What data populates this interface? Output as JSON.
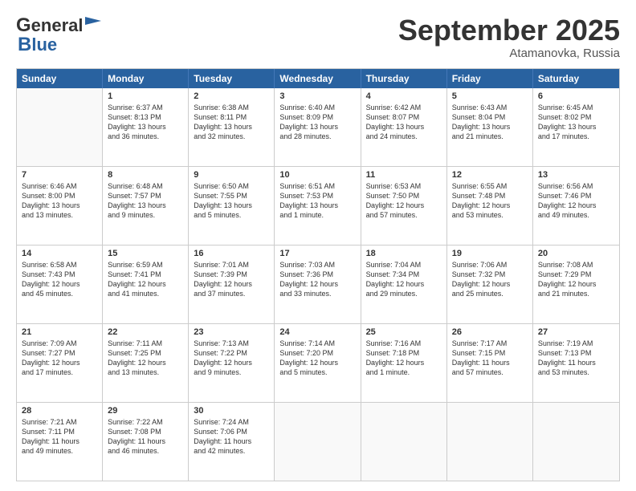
{
  "header": {
    "logo_general": "General",
    "logo_blue": "Blue",
    "month_title": "September 2025",
    "subtitle": "Atamanovka, Russia"
  },
  "days_of_week": [
    "Sunday",
    "Monday",
    "Tuesday",
    "Wednesday",
    "Thursday",
    "Friday",
    "Saturday"
  ],
  "weeks": [
    [
      {
        "day": "",
        "empty": true,
        "lines": []
      },
      {
        "day": "1",
        "empty": false,
        "lines": [
          "Sunrise: 6:37 AM",
          "Sunset: 8:13 PM",
          "Daylight: 13 hours",
          "and 36 minutes."
        ]
      },
      {
        "day": "2",
        "empty": false,
        "lines": [
          "Sunrise: 6:38 AM",
          "Sunset: 8:11 PM",
          "Daylight: 13 hours",
          "and 32 minutes."
        ]
      },
      {
        "day": "3",
        "empty": false,
        "lines": [
          "Sunrise: 6:40 AM",
          "Sunset: 8:09 PM",
          "Daylight: 13 hours",
          "and 28 minutes."
        ]
      },
      {
        "day": "4",
        "empty": false,
        "lines": [
          "Sunrise: 6:42 AM",
          "Sunset: 8:07 PM",
          "Daylight: 13 hours",
          "and 24 minutes."
        ]
      },
      {
        "day": "5",
        "empty": false,
        "lines": [
          "Sunrise: 6:43 AM",
          "Sunset: 8:04 PM",
          "Daylight: 13 hours",
          "and 21 minutes."
        ]
      },
      {
        "day": "6",
        "empty": false,
        "lines": [
          "Sunrise: 6:45 AM",
          "Sunset: 8:02 PM",
          "Daylight: 13 hours",
          "and 17 minutes."
        ]
      }
    ],
    [
      {
        "day": "7",
        "empty": false,
        "lines": [
          "Sunrise: 6:46 AM",
          "Sunset: 8:00 PM",
          "Daylight: 13 hours",
          "and 13 minutes."
        ]
      },
      {
        "day": "8",
        "empty": false,
        "lines": [
          "Sunrise: 6:48 AM",
          "Sunset: 7:57 PM",
          "Daylight: 13 hours",
          "and 9 minutes."
        ]
      },
      {
        "day": "9",
        "empty": false,
        "lines": [
          "Sunrise: 6:50 AM",
          "Sunset: 7:55 PM",
          "Daylight: 13 hours",
          "and 5 minutes."
        ]
      },
      {
        "day": "10",
        "empty": false,
        "lines": [
          "Sunrise: 6:51 AM",
          "Sunset: 7:53 PM",
          "Daylight: 13 hours",
          "and 1 minute."
        ]
      },
      {
        "day": "11",
        "empty": false,
        "lines": [
          "Sunrise: 6:53 AM",
          "Sunset: 7:50 PM",
          "Daylight: 12 hours",
          "and 57 minutes."
        ]
      },
      {
        "day": "12",
        "empty": false,
        "lines": [
          "Sunrise: 6:55 AM",
          "Sunset: 7:48 PM",
          "Daylight: 12 hours",
          "and 53 minutes."
        ]
      },
      {
        "day": "13",
        "empty": false,
        "lines": [
          "Sunrise: 6:56 AM",
          "Sunset: 7:46 PM",
          "Daylight: 12 hours",
          "and 49 minutes."
        ]
      }
    ],
    [
      {
        "day": "14",
        "empty": false,
        "lines": [
          "Sunrise: 6:58 AM",
          "Sunset: 7:43 PM",
          "Daylight: 12 hours",
          "and 45 minutes."
        ]
      },
      {
        "day": "15",
        "empty": false,
        "lines": [
          "Sunrise: 6:59 AM",
          "Sunset: 7:41 PM",
          "Daylight: 12 hours",
          "and 41 minutes."
        ]
      },
      {
        "day": "16",
        "empty": false,
        "lines": [
          "Sunrise: 7:01 AM",
          "Sunset: 7:39 PM",
          "Daylight: 12 hours",
          "and 37 minutes."
        ]
      },
      {
        "day": "17",
        "empty": false,
        "lines": [
          "Sunrise: 7:03 AM",
          "Sunset: 7:36 PM",
          "Daylight: 12 hours",
          "and 33 minutes."
        ]
      },
      {
        "day": "18",
        "empty": false,
        "lines": [
          "Sunrise: 7:04 AM",
          "Sunset: 7:34 PM",
          "Daylight: 12 hours",
          "and 29 minutes."
        ]
      },
      {
        "day": "19",
        "empty": false,
        "lines": [
          "Sunrise: 7:06 AM",
          "Sunset: 7:32 PM",
          "Daylight: 12 hours",
          "and 25 minutes."
        ]
      },
      {
        "day": "20",
        "empty": false,
        "lines": [
          "Sunrise: 7:08 AM",
          "Sunset: 7:29 PM",
          "Daylight: 12 hours",
          "and 21 minutes."
        ]
      }
    ],
    [
      {
        "day": "21",
        "empty": false,
        "lines": [
          "Sunrise: 7:09 AM",
          "Sunset: 7:27 PM",
          "Daylight: 12 hours",
          "and 17 minutes."
        ]
      },
      {
        "day": "22",
        "empty": false,
        "lines": [
          "Sunrise: 7:11 AM",
          "Sunset: 7:25 PM",
          "Daylight: 12 hours",
          "and 13 minutes."
        ]
      },
      {
        "day": "23",
        "empty": false,
        "lines": [
          "Sunrise: 7:13 AM",
          "Sunset: 7:22 PM",
          "Daylight: 12 hours",
          "and 9 minutes."
        ]
      },
      {
        "day": "24",
        "empty": false,
        "lines": [
          "Sunrise: 7:14 AM",
          "Sunset: 7:20 PM",
          "Daylight: 12 hours",
          "and 5 minutes."
        ]
      },
      {
        "day": "25",
        "empty": false,
        "lines": [
          "Sunrise: 7:16 AM",
          "Sunset: 7:18 PM",
          "Daylight: 12 hours",
          "and 1 minute."
        ]
      },
      {
        "day": "26",
        "empty": false,
        "lines": [
          "Sunrise: 7:17 AM",
          "Sunset: 7:15 PM",
          "Daylight: 11 hours",
          "and 57 minutes."
        ]
      },
      {
        "day": "27",
        "empty": false,
        "lines": [
          "Sunrise: 7:19 AM",
          "Sunset: 7:13 PM",
          "Daylight: 11 hours",
          "and 53 minutes."
        ]
      }
    ],
    [
      {
        "day": "28",
        "empty": false,
        "lines": [
          "Sunrise: 7:21 AM",
          "Sunset: 7:11 PM",
          "Daylight: 11 hours",
          "and 49 minutes."
        ]
      },
      {
        "day": "29",
        "empty": false,
        "lines": [
          "Sunrise: 7:22 AM",
          "Sunset: 7:08 PM",
          "Daylight: 11 hours",
          "and 46 minutes."
        ]
      },
      {
        "day": "30",
        "empty": false,
        "lines": [
          "Sunrise: 7:24 AM",
          "Sunset: 7:06 PM",
          "Daylight: 11 hours",
          "and 42 minutes."
        ]
      },
      {
        "day": "",
        "empty": true,
        "lines": []
      },
      {
        "day": "",
        "empty": true,
        "lines": []
      },
      {
        "day": "",
        "empty": true,
        "lines": []
      },
      {
        "day": "",
        "empty": true,
        "lines": []
      }
    ]
  ]
}
